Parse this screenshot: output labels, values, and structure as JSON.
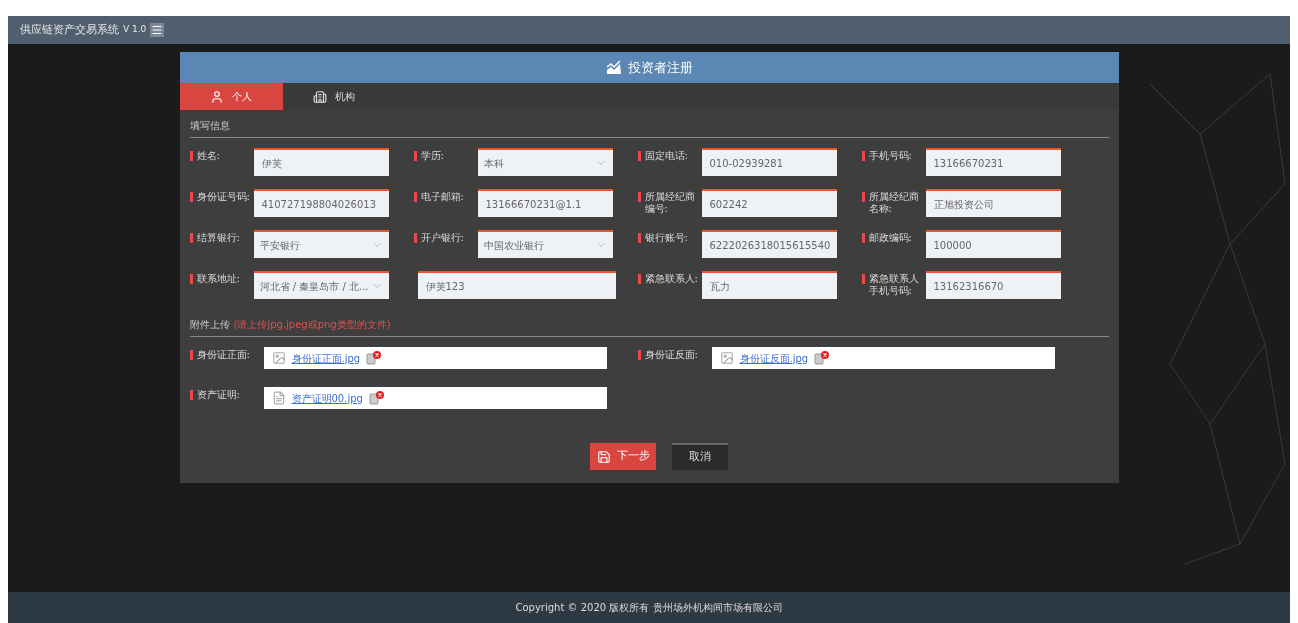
{
  "app_header": {
    "title": "供应链资产交易系统",
    "version": "V 1.0"
  },
  "dialog": {
    "title": "投资者注册",
    "tabs": [
      {
        "label": "个人",
        "kind": "person",
        "selected": true
      },
      {
        "label": "机构",
        "kind": "building",
        "selected": false
      }
    ],
    "info_section": {
      "title": "填写信息"
    },
    "fields": [
      {
        "label": "姓名:",
        "value": "伊芙",
        "kind": "text"
      },
      {
        "label": "学历:",
        "value": "本科",
        "kind": "select"
      },
      {
        "label": "固定电话:",
        "value": "010-02939281",
        "kind": "text"
      },
      {
        "label": "手机号码:",
        "value": "13166670231",
        "kind": "text"
      },
      {
        "label": "身份证号码:",
        "value": "410727198804026013",
        "kind": "text"
      },
      {
        "label": "电子邮箱:",
        "value": "13166670231@1.1",
        "kind": "text"
      },
      {
        "label": "所属经纪商编号:",
        "value": "602242",
        "kind": "text"
      },
      {
        "label": "所属经纪商名称:",
        "value": "正旭投资公司",
        "kind": "text"
      },
      {
        "label": "结算银行:",
        "value": "平安银行",
        "kind": "select"
      },
      {
        "label": "开户银行:",
        "value": "中国农业银行",
        "kind": "select"
      },
      {
        "label": "银行账号:",
        "value": "6222026318015615540",
        "kind": "text"
      },
      {
        "label": "邮政编码:",
        "value": "100000",
        "kind": "text"
      },
      {
        "label": "联系地址:",
        "value": "河北省 / 秦皇岛市 / 北...",
        "detail": "伊芙123",
        "kind": "address"
      },
      {
        "label": "紧急联系人:",
        "value": "瓦力",
        "kind": "text"
      },
      {
        "label": "紧急联系人手机号码:",
        "value": "13162316670",
        "kind": "text"
      }
    ],
    "upload_section": {
      "title": "附件上传",
      "note": "(请上传jpg,jpeg或png类型的文件)"
    },
    "uploads": [
      {
        "label": "身份证正面:",
        "file": "身份证正面.jpg",
        "kind": "image"
      },
      {
        "label": "身份证反面:",
        "file": "身份证反面.jpg",
        "kind": "image"
      },
      {
        "label": "资产证明:",
        "file": "资产证明00.jpg",
        "kind": "document"
      }
    ],
    "buttons": [
      {
        "label": "下一步",
        "kind": "primary"
      },
      {
        "label": "取消",
        "kind": "secondary"
      }
    ]
  },
  "footer": {
    "text": "Copyright © 2020 版权所有 贵州场外机构间市场有限公司"
  }
}
